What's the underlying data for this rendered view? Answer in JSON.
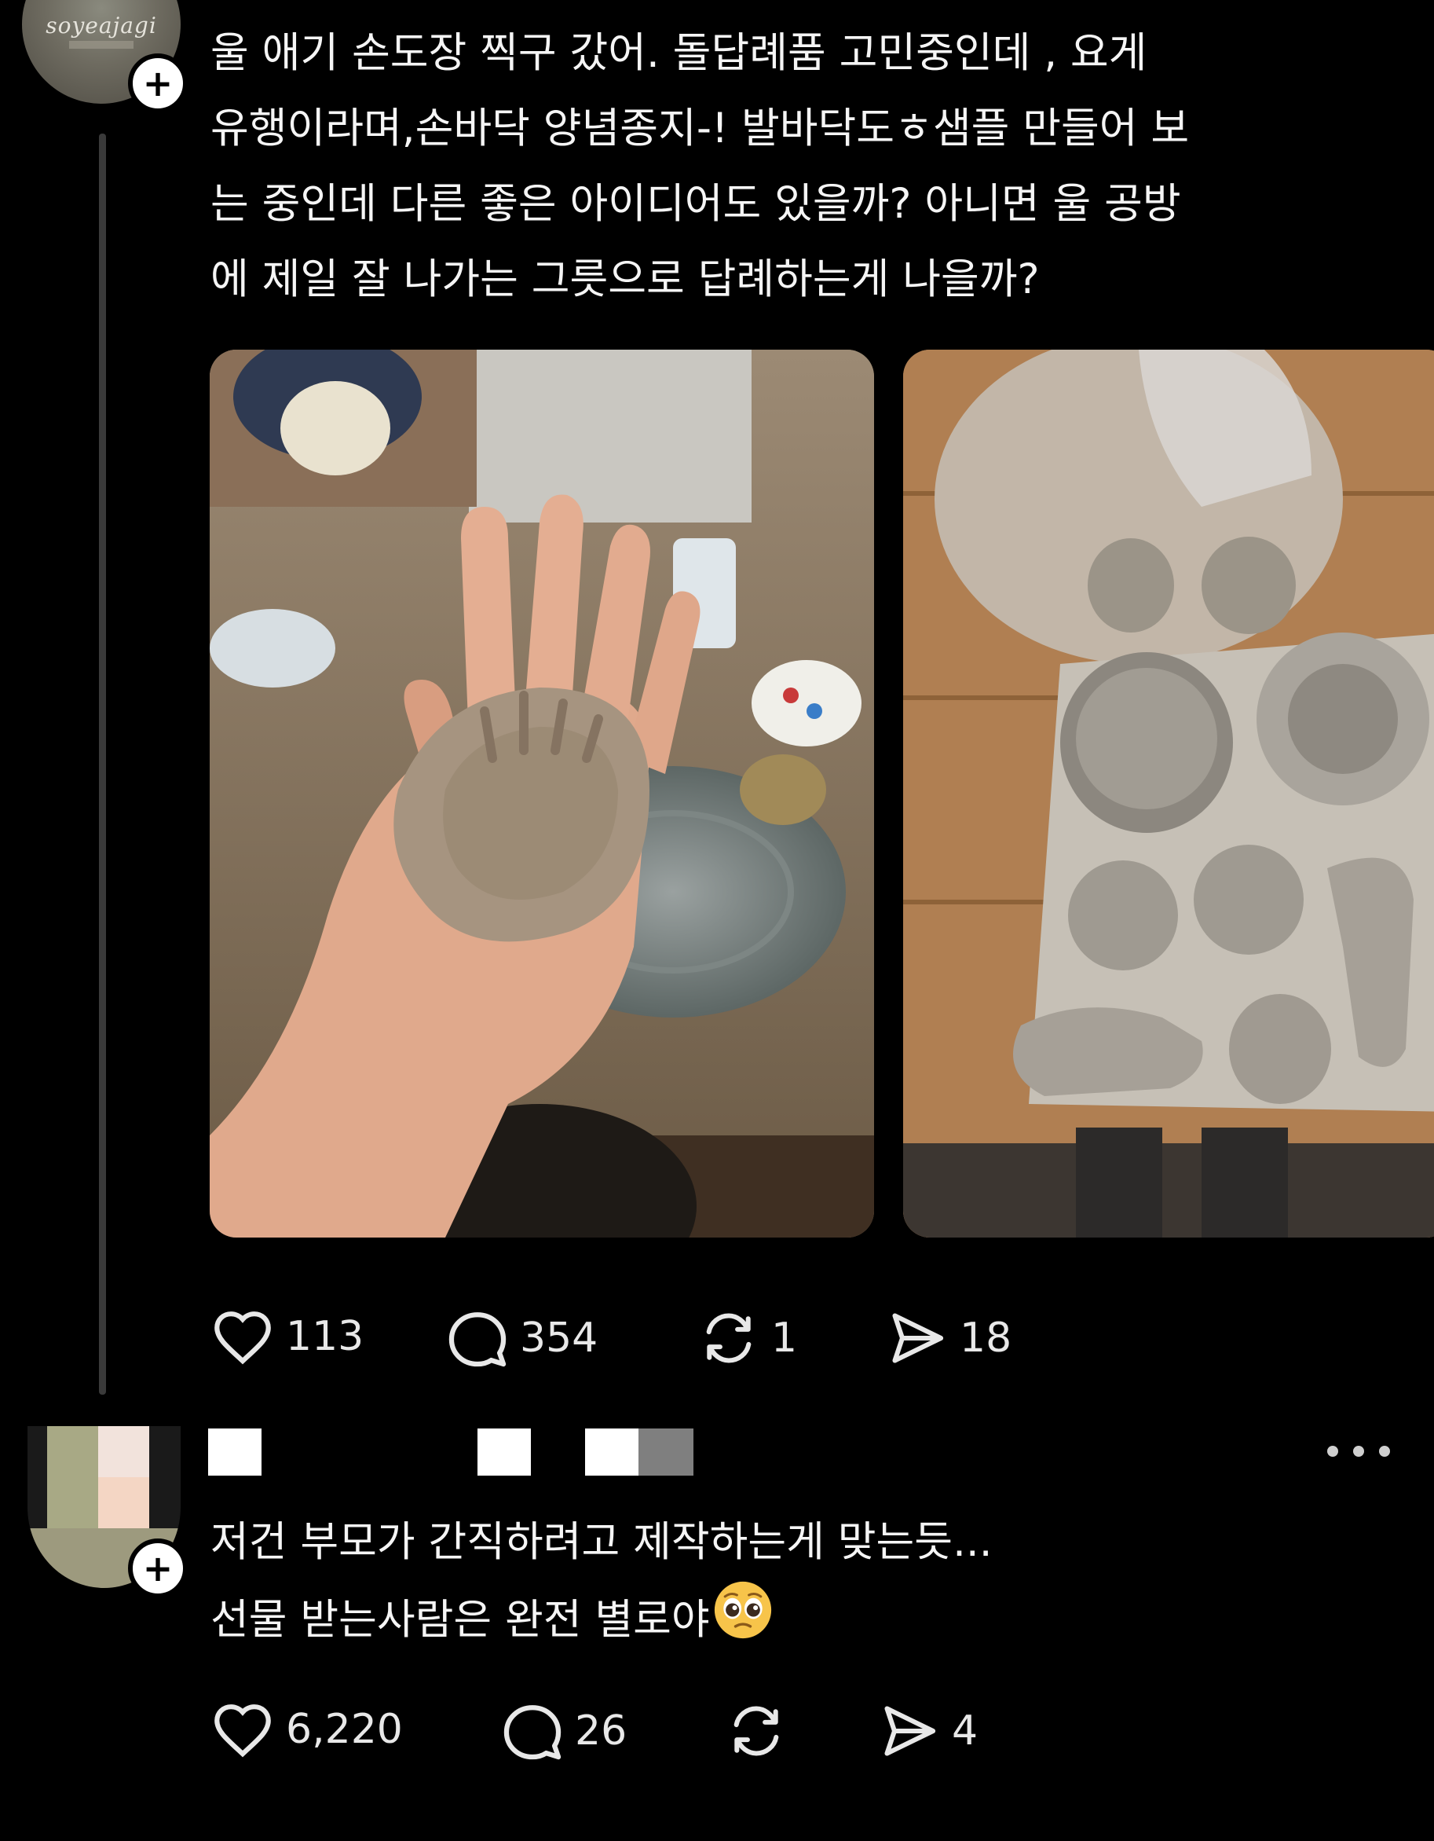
{
  "post": {
    "avatar_text": "soyeajagi",
    "text_lines": [
      "울 애기 손도장 찍구 갔어.  돌답례품 고민중인데 , 요게",
      "유행이라며,손바닥 양념종지-! 발바닥도ㅎ샘플 만들어 보",
      "는 중인데 다른 좋은 아이디어도 있을까? 아니면 울 공방",
      "에 제일 잘 나가는 그릇으로 답례하는게 나을까?"
    ],
    "stats": {
      "likes": "113",
      "comments": "354",
      "reposts": "1",
      "shares": "18"
    }
  },
  "reply": {
    "text_lines": [
      "저건 부모가 간직하려고 제작하는게 맞는듯...",
      "선물 받는사람은 완전 별로야"
    ],
    "stats": {
      "likes": "6,220",
      "comments": "26",
      "reposts": "",
      "shares": "4"
    }
  },
  "icons": {
    "follow_badge": "plus-icon",
    "like": "heart-icon",
    "comment": "comment-bubble-icon",
    "repost": "repost-icon",
    "share": "send-icon",
    "more": "more-dots-icon",
    "emoji": "pleading-face-emoji"
  },
  "colors": {
    "background": "#000000",
    "text": "#f5f5f5",
    "icon": "#e8e8e8",
    "thread_line": "#3a3a3a"
  }
}
